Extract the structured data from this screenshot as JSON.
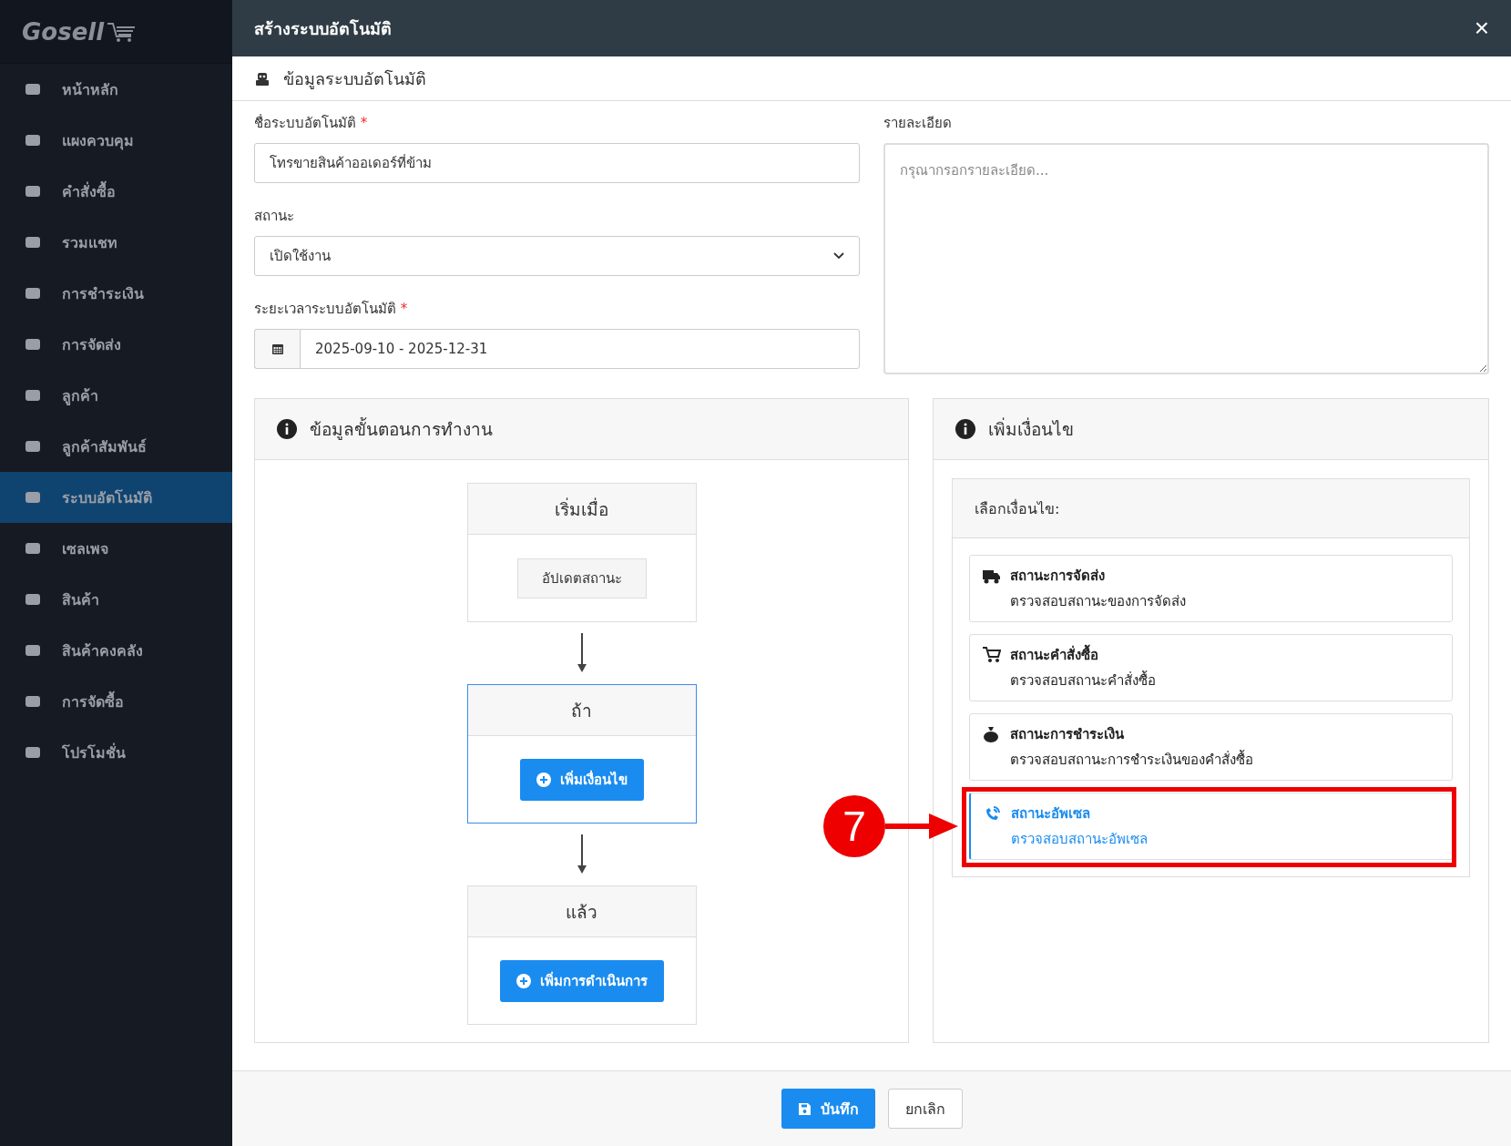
{
  "sidebar": {
    "logo": "Gosell",
    "items": [
      {
        "label": "หน้าหลัก",
        "selected": false
      },
      {
        "label": "แผงควบคุม",
        "selected": false
      },
      {
        "label": "คำสั่งซื้อ",
        "selected": false
      },
      {
        "label": "รวมแชท",
        "selected": false
      },
      {
        "label": "การชำระเงิน",
        "selected": false
      },
      {
        "label": "การจัดส่ง",
        "selected": false
      },
      {
        "label": "ลูกค้า",
        "selected": false
      },
      {
        "label": "ลูกค้าสัมพันธ์",
        "selected": false
      },
      {
        "label": "ระบบอัตโนมัติ",
        "selected": true
      },
      {
        "label": "เซลเพจ",
        "selected": false
      },
      {
        "label": "สินค้า",
        "selected": false
      },
      {
        "label": "สินค้าคงคลัง",
        "selected": false
      },
      {
        "label": "การจัดซื้อ",
        "selected": false
      },
      {
        "label": "โปรโมชั่น",
        "selected": false
      }
    ]
  },
  "dialog": {
    "title": "สร้างระบบอัตโนมัติ",
    "close": "×",
    "section_title": "ข้อมูลระบบอัตโนมัติ"
  },
  "form": {
    "name": {
      "label": "ชื่อระบบอัตโนมัติ",
      "required": "*",
      "value": "โทรขายสินค้าออเดอร์ที่ข้าม"
    },
    "status": {
      "label": "สถานะ",
      "value": "เปิดใช้งาน"
    },
    "period": {
      "label": "ระยะเวลาระบบอัตโนมัติ",
      "required": "*",
      "value": "2025-09-10 - 2025-12-31"
    },
    "details": {
      "label": "รายละเอียด",
      "placeholder": "กรุณากรอกรายละเอียด..."
    }
  },
  "workflow": {
    "title": "ข้อมูลขั้นตอนการทำงาน",
    "steps": [
      {
        "title": "เริ่มเมื่อ",
        "kind": "trigger",
        "button": "อัปเดตสถานะ",
        "focused": false
      },
      {
        "title": "ถ้า",
        "kind": "condition",
        "button": "เพิ่มเงื่อนไข",
        "focused": true
      },
      {
        "title": "แล้ว",
        "kind": "action",
        "button": "เพิ่มการดำเนินการ",
        "focused": false
      }
    ]
  },
  "conditions": {
    "title": "เพิ่มเงื่อนไข",
    "heading": "เลือกเงื่อนไข:",
    "items": [
      {
        "title": "สถานะการจัดส่ง",
        "description": "ตรวจสอบสถานะของการจัดส่ง",
        "selected": false
      },
      {
        "title": "สถานะคำสั่งซื้อ",
        "description": "ตรวจสอบสถานะคำสั่งซื้อ",
        "selected": false
      },
      {
        "title": "สถานะการชำระเงิน",
        "description": "ตรวจสอบสถานะการชำระเงินของคำสั่งซื้อ",
        "selected": false
      },
      {
        "title": "สถานะอัพเซล",
        "description": "ตรวจสอบสถานะอัพเซล",
        "selected": true,
        "callout": "7"
      }
    ]
  },
  "footer": {
    "save": "บันทึก",
    "cancel": "ยกเลิก"
  }
}
